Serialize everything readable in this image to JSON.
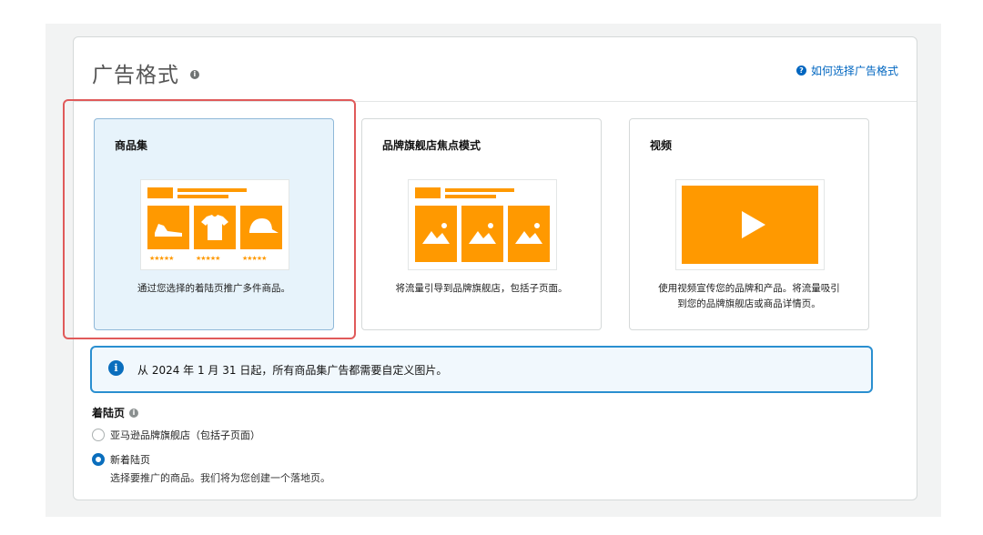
{
  "section": {
    "title": "广告格式",
    "help_link": "如何选择广告格式"
  },
  "formats": [
    {
      "title": "商品集",
      "description": "通过您选择的着陆页推广多件商品。",
      "selected": true
    },
    {
      "title": "品牌旗舰店焦点模式",
      "description": "将流量引导到品牌旗舰店，包括子页面。",
      "selected": false
    },
    {
      "title": "视频",
      "description": "使用视频宣传您的品牌和产品。将流量吸引到您的品牌旗舰店或商品详情页。",
      "selected": false
    }
  ],
  "notice": {
    "text": "从 2024 年 1 月 31 日起，所有商品集广告都需要自定义图片。"
  },
  "landing_page": {
    "label": "着陆页",
    "options": [
      {
        "label": "亚马逊品牌旗舰店（包括子页面）",
        "checked": false
      },
      {
        "label": "新着陆页",
        "checked": true,
        "description": "选择要推广的商品。我们将为您创建一个落地页。"
      }
    ]
  },
  "colors": {
    "accent": "#ff9900",
    "link": "#0066c0",
    "highlight": "#e05a5a",
    "info": "#2a8fd0"
  }
}
